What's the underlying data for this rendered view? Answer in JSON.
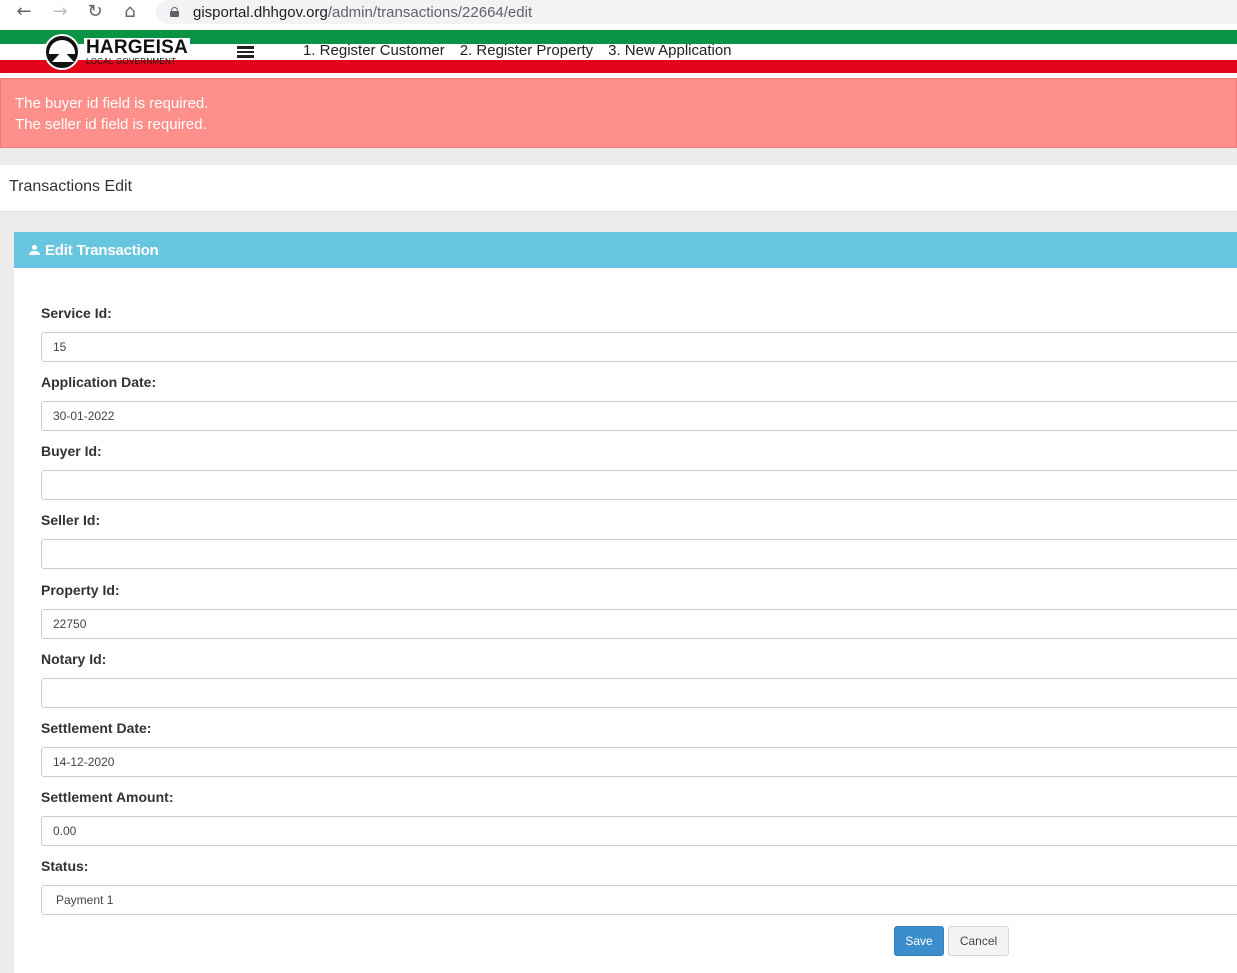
{
  "browser": {
    "url_domain": "gisportal.dhhgov.org",
    "url_path": "/admin/transactions/22664/edit"
  },
  "header": {
    "logo_title": "HARGEISA",
    "logo_subtitle": "LOCAL GOVERNMENT",
    "logo_badge": "CHA",
    "nav_links": [
      "1. Register Customer",
      "2. Register Property",
      "3. New Application"
    ]
  },
  "alert": {
    "messages": [
      "The buyer id field is required.",
      "The seller id field is required."
    ]
  },
  "page": {
    "title": "Transactions Edit"
  },
  "panel": {
    "heading": "Edit Transaction",
    "fields": [
      {
        "label": "Service Id:",
        "value": ""
      },
      {
        "label": "Application Date:",
        "value": "30-01-2022"
      },
      {
        "label": "Buyer Id:",
        "value": ""
      },
      {
        "label": "Seller Id:",
        "value": ""
      },
      {
        "label": "Property Id:",
        "value": "22750"
      },
      {
        "label": "Notary Id:",
        "value": ""
      },
      {
        "label": "Settlement Date:",
        "value": "14-12-2020"
      },
      {
        "label": "Settlement Amount:",
        "value": "0.00"
      },
      {
        "label": "Status:",
        "value": "Payment 1"
      }
    ],
    "service_id": "15",
    "save_label": "Save",
    "cancel_label": "Cancel"
  },
  "colors": {
    "flag_green": "#0a9345",
    "flag_red": "#e3061b",
    "alert_bg": "#ff8f8a",
    "panel_heading": "#68c5df",
    "save_button": "#3c8dcb"
  }
}
